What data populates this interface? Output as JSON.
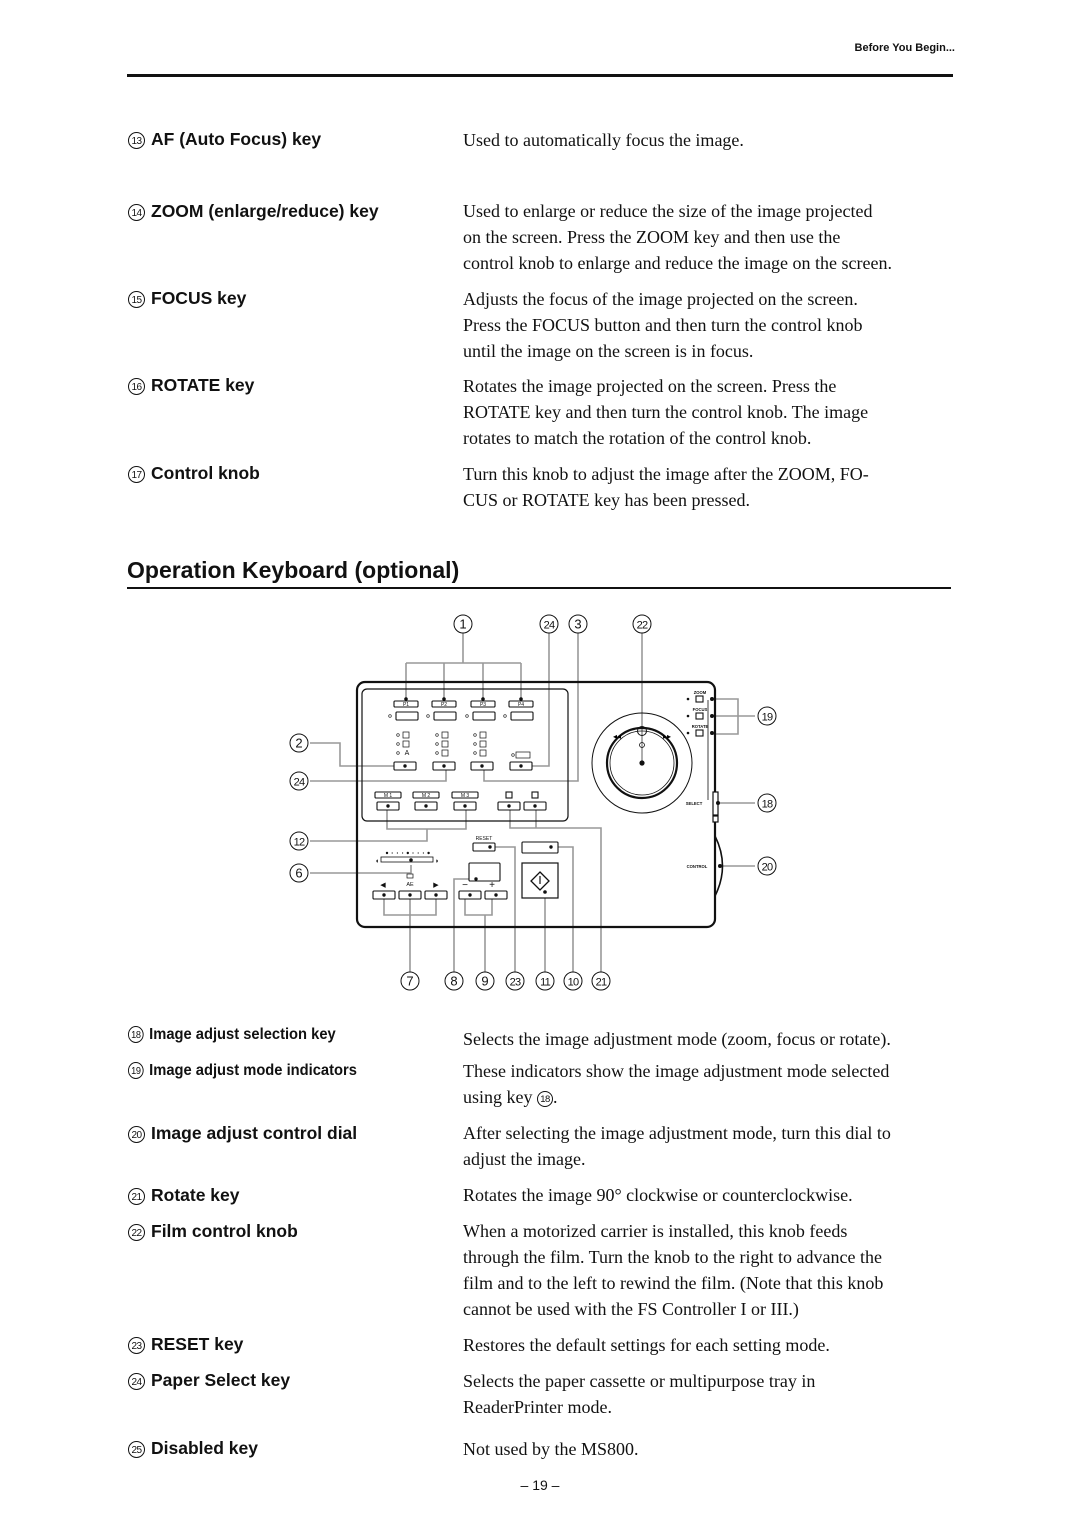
{
  "header": {
    "running_title": "Before You Begin..."
  },
  "upper_items": [
    {
      "num": "13",
      "term": "AF (Auto Focus) key",
      "desc": [
        "Used to automatically focus the image."
      ]
    },
    {
      "num": "14",
      "term": "ZOOM (enlarge/reduce) key",
      "desc": [
        "Used to enlarge or reduce the size of the image projected",
        "on the screen. Press the ZOOM key and then use the",
        "control knob to enlarge and reduce the image on the screen."
      ]
    },
    {
      "num": "15",
      "term": "FOCUS key",
      "desc": [
        "Adjusts the focus of the image projected on the screen.",
        "Press the FOCUS button and then turn the control knob",
        "until the image on the screen is in focus."
      ]
    },
    {
      "num": "16",
      "term": "ROTATE key",
      "desc": [
        "Rotates the image projected on the screen. Press the",
        "ROTATE key and then turn the control knob. The image",
        "rotates to match the rotation of the control knob."
      ]
    },
    {
      "num": "17",
      "term": "Control knob",
      "desc": [
        "Turn this knob to adjust the image after the ZOOM, FO-",
        "CUS or ROTATE key has been pressed."
      ]
    }
  ],
  "section": {
    "title": "Operation Keyboard (optional)"
  },
  "diagram": {
    "callouts_top": [
      "1",
      "24",
      "3",
      "22"
    ],
    "callouts_left": [
      "2",
      "24",
      "12",
      "6"
    ],
    "callouts_right": [
      "19",
      "18",
      "20"
    ],
    "callouts_bottom": [
      "7",
      "8",
      "9",
      "23",
      "11",
      "10",
      "21"
    ],
    "preset_labels": [
      "P1",
      "P2",
      "P3",
      "P4"
    ],
    "memory_labels": [
      "M 1",
      "M 2",
      "M 3"
    ],
    "reset_label": "RESET",
    "ae_label": "AE",
    "minus_label": "−",
    "plus_label": "+",
    "mode_labels": {
      "zoom": "ZOOM",
      "focus": "FOCUS",
      "rotate": "ROTATE",
      "select": "SELECT",
      "control": "CONTROL"
    },
    "a_label": "A"
  },
  "lower_items": [
    {
      "num": "18",
      "term": "Image adjust selection key",
      "condensed": true,
      "desc": [
        "Selects the image adjustment mode (zoom, focus or rotate)."
      ]
    },
    {
      "num": "19",
      "term": "Image adjust mode indicators",
      "condensed": true,
      "desc": [
        "These indicators show the image adjustment mode selected"
      ],
      "desc_tail": {
        "prefix": "using key ",
        "ref": "18",
        "suffix": "."
      }
    },
    {
      "num": "20",
      "term": "Image adjust control dial",
      "desc": [
        "After selecting the image adjustment mode, turn this dial to",
        "adjust the image."
      ]
    },
    {
      "num": "21",
      "term": "Rotate key",
      "desc": [
        "Rotates the image 90° clockwise or counterclockwise."
      ]
    },
    {
      "num": "22",
      "term": "Film control knob",
      "desc": [
        "When a motorized carrier is installed, this knob feeds",
        "through the film. Turn the knob to the right to advance the",
        "film and to the left to rewind the film. (Note that this knob",
        "cannot be used with the FS Controller I or III.)"
      ]
    },
    {
      "num": "23",
      "term": "RESET key",
      "desc": [
        "Restores the default settings for each setting mode."
      ]
    },
    {
      "num": "24",
      "term": "Paper Select key",
      "desc": [
        "Selects the paper cassette or multipurpose tray in",
        "ReaderPrinter mode."
      ]
    },
    {
      "num": "25",
      "term": "Disabled key",
      "desc": [
        "Not used by the MS800."
      ]
    }
  ],
  "footer": {
    "page_number": "– 19 –"
  }
}
